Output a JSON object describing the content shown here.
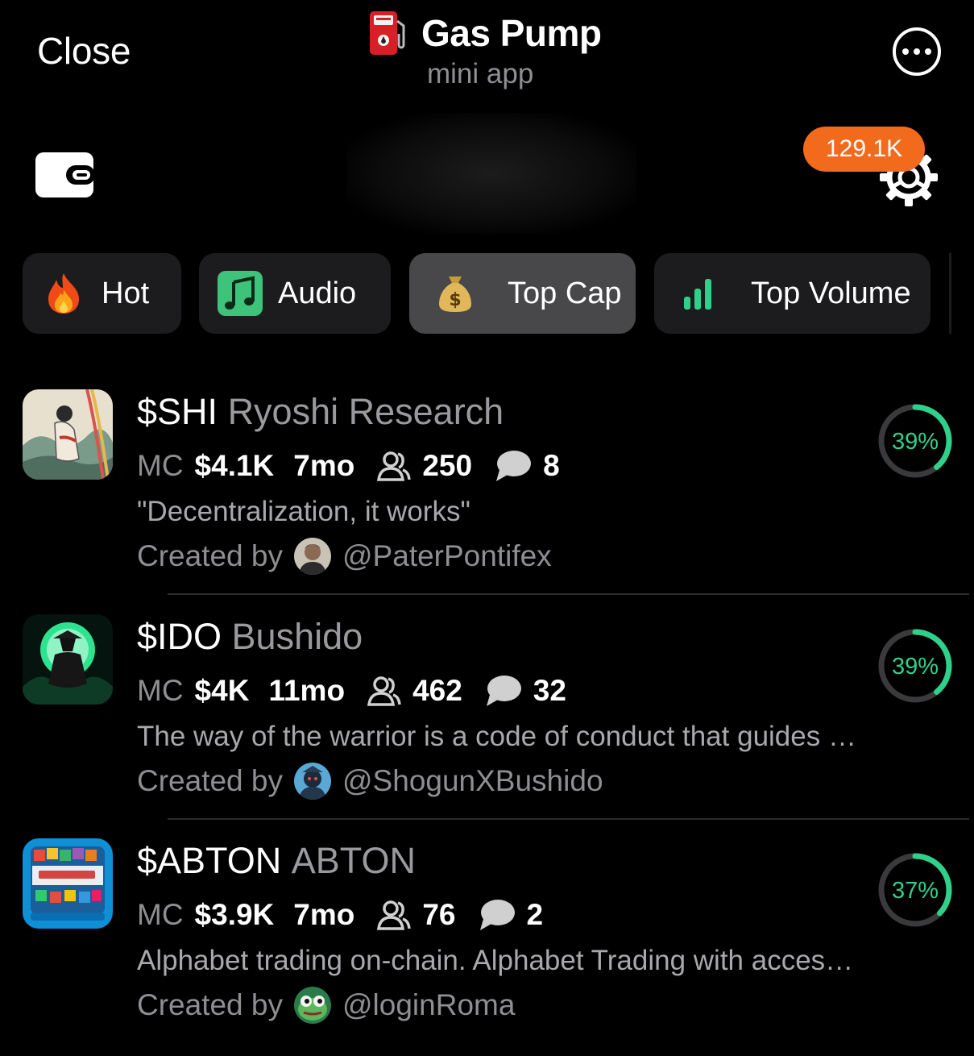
{
  "header": {
    "close_label": "Close",
    "title": "Gas Pump",
    "subtitle": "mini app",
    "more_icon": "ellipsis-circle-icon"
  },
  "topbar": {
    "balance": "129.1K",
    "wallet_icon": "wallet-icon",
    "settings_icon": "gear-icon"
  },
  "tabs": [
    {
      "label": "Hot",
      "icon": "fire-icon",
      "active": false
    },
    {
      "label": "Audio",
      "icon": "music-note-icon",
      "active": false
    },
    {
      "label": "Top Cap",
      "icon": "money-bag-icon",
      "active": true
    },
    {
      "label": "Top Volume",
      "icon": "bar-chart-icon",
      "active": false
    }
  ],
  "tokens": [
    {
      "symbol": "$SHI",
      "name": "Ryoshi Research",
      "mc_label": "MC",
      "mc": "$4.1K",
      "age": "7mo",
      "holders": "250",
      "comments": "8",
      "description": "\"Decentralization, it works\"",
      "created_by_label": "Created by",
      "creator": "@PaterPontifex",
      "progress_pct": 39,
      "progress_label": "39%"
    },
    {
      "symbol": "$IDO",
      "name": "Bushido",
      "mc_label": "MC",
      "mc": "$4K",
      "age": "11mo",
      "holders": "462",
      "comments": "32",
      "description": "The way of the warrior is a code of conduct that guides …",
      "created_by_label": "Created by",
      "creator": "@ShogunXBushido",
      "progress_pct": 39,
      "progress_label": "39%"
    },
    {
      "symbol": "$ABTON",
      "name": "ABTON",
      "mc_label": "MC",
      "mc": "$3.9K",
      "age": "7mo",
      "holders": "76",
      "comments": "2",
      "description": "Alphabet trading on-chain. Alphabet Trading with acces…",
      "created_by_label": "Created by",
      "creator": "@loginRoma",
      "progress_pct": 37,
      "progress_label": "37%"
    }
  ],
  "colors": {
    "accent_orange": "#f26b1d",
    "progress_green": "#2fd18a",
    "progress_track": "#3a3a3c",
    "muted_text": "#8e8e93"
  }
}
